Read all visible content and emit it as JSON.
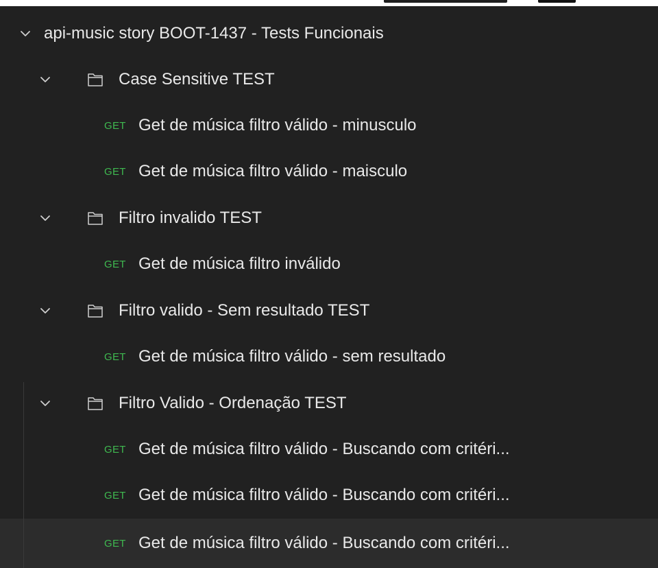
{
  "collection": {
    "name": "api-music story BOOT-1437 - Tests Funcionais"
  },
  "folders": [
    {
      "name": "Case Sensitive TEST",
      "requests": [
        {
          "method": "GET",
          "name": "Get de música filtro válido - minusculo"
        },
        {
          "method": "GET",
          "name": "Get de música filtro válido - maisculo"
        }
      ]
    },
    {
      "name": "Filtro invalido TEST",
      "requests": [
        {
          "method": "GET",
          "name": "Get de música filtro inválido"
        }
      ]
    },
    {
      "name": "Filtro valido - Sem resultado TEST",
      "requests": [
        {
          "method": "GET",
          "name": "Get de música filtro válido - sem resultado"
        }
      ]
    },
    {
      "name": "Filtro Valido - Ordenação TEST",
      "requests": [
        {
          "method": "GET",
          "name": "Get de música filtro válido - Buscando com critéri..."
        },
        {
          "method": "GET",
          "name": "Get de música filtro válido - Buscando com critéri..."
        },
        {
          "method": "GET",
          "name": "Get de música filtro válido - Buscando com critéri..."
        }
      ]
    }
  ],
  "colors": {
    "background": "#212121",
    "hover_row": "#2c2c2c",
    "text": "#e9e9e9",
    "get_method": "#3fb950"
  },
  "icons": {
    "expand": "chevron-down-icon",
    "folder": "folder-icon"
  }
}
